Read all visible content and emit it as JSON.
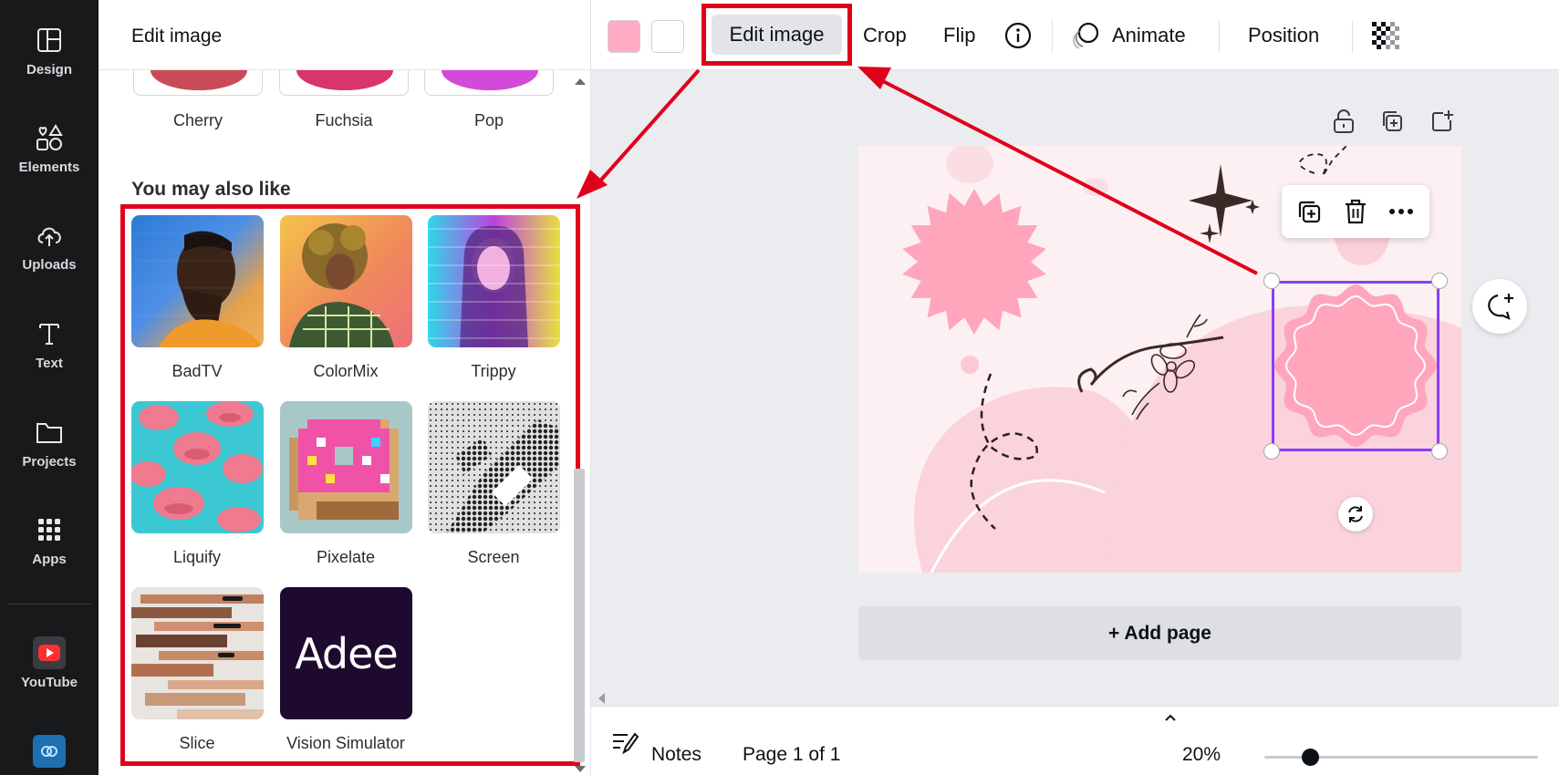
{
  "rail": {
    "items": [
      {
        "label": "Design",
        "icon": "layout-icon"
      },
      {
        "label": "Elements",
        "icon": "shapes-icon"
      },
      {
        "label": "Uploads",
        "icon": "cloud-upload-icon"
      },
      {
        "label": "Text",
        "icon": "text-icon"
      },
      {
        "label": "Projects",
        "icon": "folder-icon"
      },
      {
        "label": "Apps",
        "icon": "grid-icon"
      },
      {
        "label": "YouTube",
        "icon": "youtube-icon"
      }
    ]
  },
  "panel": {
    "title": "Edit image",
    "previous_effects": [
      {
        "label": "Cherry",
        "color": "#c94b58"
      },
      {
        "label": "Fuchsia",
        "color": "#d8346d"
      },
      {
        "label": "Pop",
        "color": "#d24ad8"
      }
    ],
    "section_title": "You may also like",
    "effects": [
      {
        "label": "BadTV"
      },
      {
        "label": "ColorMix"
      },
      {
        "label": "Trippy"
      },
      {
        "label": "Liquify"
      },
      {
        "label": "Pixelate"
      },
      {
        "label": "Screen"
      },
      {
        "label": "Slice"
      },
      {
        "label": "Vision Simulator",
        "logo_text": "Adee"
      }
    ]
  },
  "toolbar": {
    "swatch_colors": [
      "#ffabc3",
      "#ffffff"
    ],
    "edit_image_label": "Edit image",
    "crop_label": "Crop",
    "flip_label": "Flip",
    "animate_label": "Animate",
    "position_label": "Position"
  },
  "canvas": {
    "add_page_label": "+ Add page",
    "background": "#fdf0f2",
    "accent": "#ffa6bc"
  },
  "bottom_bar": {
    "notes_label": "Notes",
    "page_indicator": "Page 1 of 1",
    "zoom": "20%"
  },
  "annotation_color": "#e0001b"
}
